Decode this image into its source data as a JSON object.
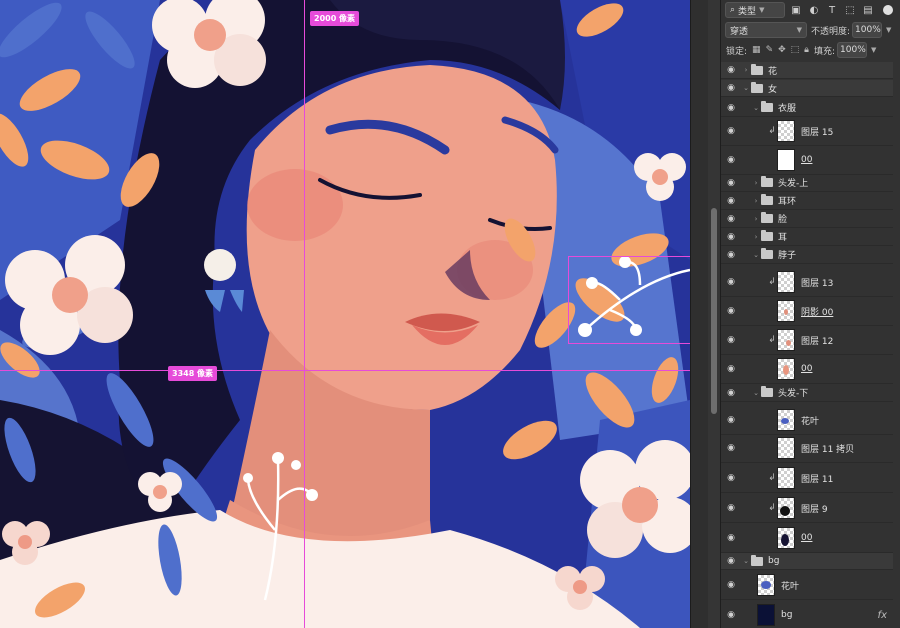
{
  "canvas": {
    "measure_width": "3348 像素",
    "measure_height": "2000 像素"
  },
  "panel": {
    "filter_kind": "类型",
    "blend_mode": "穿透",
    "opacity_label": "不透明度:",
    "opacity_value": "100%",
    "lock_label": "锁定:",
    "fill_label": "填充:",
    "fill_value": "100%"
  },
  "layers": [
    {
      "name": "花",
      "kind": "group",
      "depth": 0,
      "expanded": false
    },
    {
      "name": "女",
      "kind": "group",
      "depth": 0,
      "expanded": true
    },
    {
      "name": "衣服",
      "kind": "group",
      "depth": 1,
      "expanded": true
    },
    {
      "name": "图层 15",
      "kind": "layer",
      "depth": 2,
      "clipped": true
    },
    {
      "name": "00",
      "kind": "layer",
      "depth": 2,
      "underline": true
    },
    {
      "name": "头发-上",
      "kind": "group",
      "depth": 1,
      "expanded": false
    },
    {
      "name": "耳环",
      "kind": "group",
      "depth": 1,
      "expanded": false
    },
    {
      "name": "脸",
      "kind": "group",
      "depth": 1,
      "expanded": false
    },
    {
      "name": "耳",
      "kind": "group",
      "depth": 1,
      "expanded": false
    },
    {
      "name": "脖子",
      "kind": "group",
      "depth": 1,
      "expanded": true
    },
    {
      "name": "图层 13",
      "kind": "layer",
      "depth": 2,
      "clipped": true
    },
    {
      "name": "阴影 00",
      "kind": "layer",
      "depth": 2,
      "underline": true
    },
    {
      "name": "图层 12",
      "kind": "layer",
      "depth": 2,
      "clipped": true
    },
    {
      "name": "00",
      "kind": "layer",
      "depth": 2,
      "underline": true
    },
    {
      "name": "头发-下",
      "kind": "group",
      "depth": 1,
      "expanded": true
    },
    {
      "name": "花叶",
      "kind": "layer",
      "depth": 2
    },
    {
      "name": "图层 11 拷贝",
      "kind": "layer",
      "depth": 2
    },
    {
      "name": "图层 11",
      "kind": "layer",
      "depth": 2,
      "clipped": true
    },
    {
      "name": "图层 9",
      "kind": "layer",
      "depth": 2,
      "clipped": true
    },
    {
      "name": "00",
      "kind": "layer",
      "depth": 2,
      "underline": true
    },
    {
      "name": "bg",
      "kind": "group",
      "depth": 0,
      "expanded": true
    },
    {
      "name": "花叶",
      "kind": "layer",
      "depth": 1
    },
    {
      "name": "bg",
      "kind": "layer",
      "depth": 1,
      "fx": "fx"
    }
  ],
  "colors": {
    "guide": "#e64bd9",
    "background": "#26339a",
    "skin": "#efa08b",
    "hair": "#141233",
    "leaf": "#f3a36b",
    "petal": "#fbeee9"
  }
}
